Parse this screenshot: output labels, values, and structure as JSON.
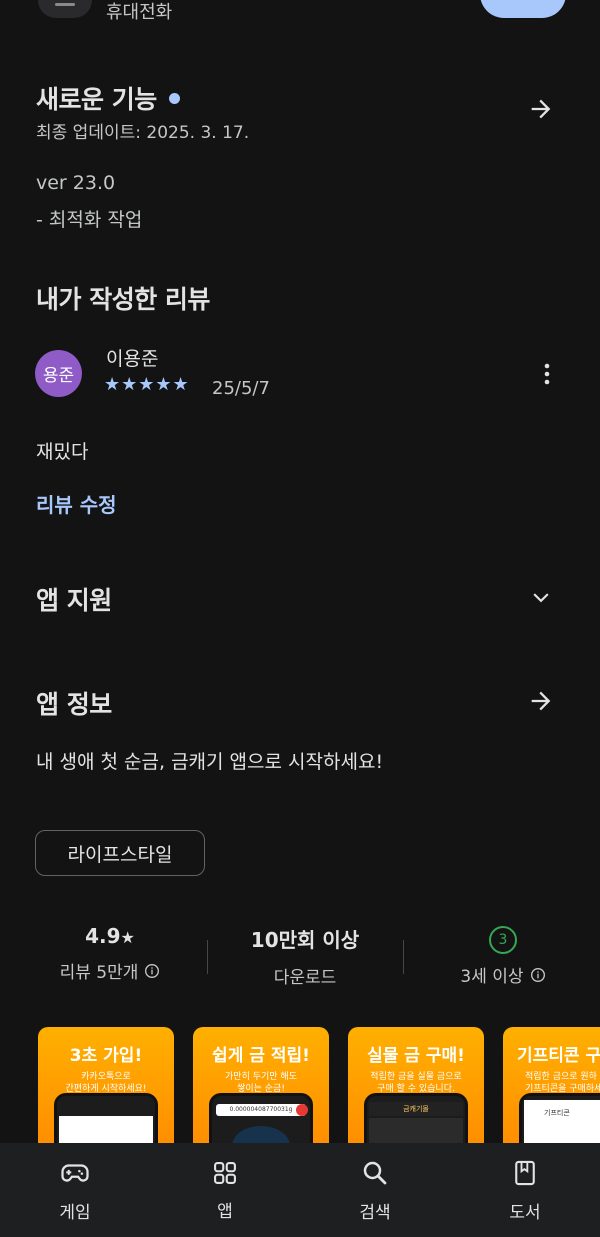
{
  "header": {
    "subtitle": "휴대전화"
  },
  "whats_new": {
    "title": "새로운 기능",
    "updated": "최종 업데이트: 2025. 3. 17.",
    "version": "ver 23.0",
    "note": "- 최적화 작업"
  },
  "review": {
    "section_title": "내가 작성한 리뷰",
    "avatar_text": "용준",
    "author": "이용준",
    "stars": "★★★★★",
    "rating": 5,
    "date": "25/5/7",
    "text": "재밌다",
    "edit_label": "리뷰 수정"
  },
  "app_support": {
    "title": "앱 지원"
  },
  "app_info": {
    "title": "앱 정보",
    "description": "내 생애 첫 순금, 금캐기 앱으로 시작하세요!",
    "category": "라이프스타일"
  },
  "stats": [
    {
      "value": "4.9",
      "star": "★",
      "label": "리뷰 5만개"
    },
    {
      "value": "10만회 이상",
      "label": "다운로드"
    },
    {
      "badge": "3",
      "label": "3세 이상"
    }
  ],
  "screenshots": [
    {
      "title": "3초 가입!",
      "desc1": "카카오톡으로",
      "desc2": "간편하게 시작하세요!"
    },
    {
      "title": "쉽게 금 적립!",
      "desc1": "가만히 두기만 해도",
      "desc2": "쌓이는 순금!",
      "counter": "0.00000408770031g"
    },
    {
      "title": "실물 금 구매!",
      "desc1": "적립한 금을 실물 금으로",
      "desc2": "구매 할 수 있습니다.",
      "screen_title": "금캐기몰"
    },
    {
      "title": "기프티콘 구",
      "desc1": "적립한 금으로 원하",
      "desc2": "기프티콘을 구매하세",
      "screen_title": "기프티콘"
    }
  ],
  "bottom_nav": [
    {
      "label": "게임",
      "icon": "gamepad-icon"
    },
    {
      "label": "앱",
      "icon": "apps-grid-icon"
    },
    {
      "label": "검색",
      "icon": "search-icon"
    },
    {
      "label": "도서",
      "icon": "book-icon"
    }
  ],
  "colors": {
    "background": "#131314",
    "accent_blue": "#a8c7fa",
    "avatar_purple": "#8e5bc7",
    "badge_green": "#34a853",
    "screenshot_orange": "#ffa000"
  }
}
